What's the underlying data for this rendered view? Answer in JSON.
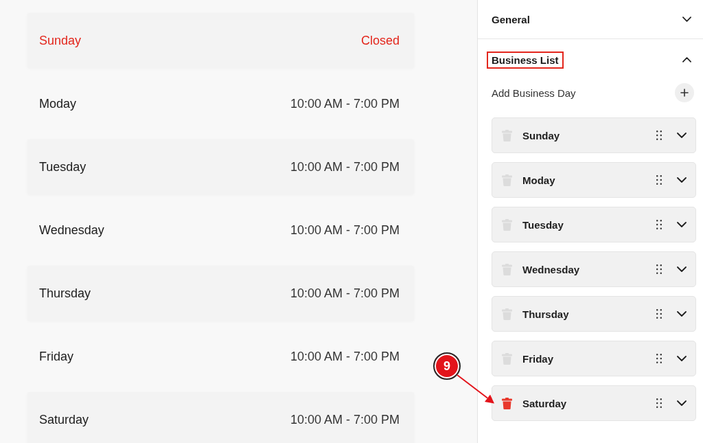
{
  "schedule": {
    "rows": [
      {
        "day": "Sunday",
        "hours": "Closed",
        "closed": true
      },
      {
        "day": "Moday",
        "hours": "10:00 AM - 7:00 PM",
        "closed": false
      },
      {
        "day": "Tuesday",
        "hours": "10:00 AM - 7:00 PM",
        "closed": false
      },
      {
        "day": "Wednesday",
        "hours": "10:00 AM - 7:00 PM",
        "closed": false
      },
      {
        "day": "Thursday",
        "hours": "10:00 AM - 7:00 PM",
        "closed": false
      },
      {
        "day": "Friday",
        "hours": "10:00 AM - 7:00 PM",
        "closed": false
      },
      {
        "day": "Saturday",
        "hours": "10:00 AM - 7:00 PM",
        "closed": false
      }
    ]
  },
  "panel": {
    "sections": [
      {
        "title": "General",
        "expanded": false,
        "annotated": false
      },
      {
        "title": "Business List",
        "expanded": true,
        "annotated": true,
        "add_label": "Add Business Day",
        "items": [
          {
            "name": "Sunday",
            "hovered": false
          },
          {
            "name": "Moday",
            "hovered": false
          },
          {
            "name": "Tuesday",
            "hovered": false
          },
          {
            "name": "Wednesday",
            "hovered": false
          },
          {
            "name": "Thursday",
            "hovered": false
          },
          {
            "name": "Friday",
            "hovered": false
          },
          {
            "name": "Saturday",
            "hovered": true
          }
        ]
      }
    ]
  },
  "callout": {
    "label": "9"
  }
}
